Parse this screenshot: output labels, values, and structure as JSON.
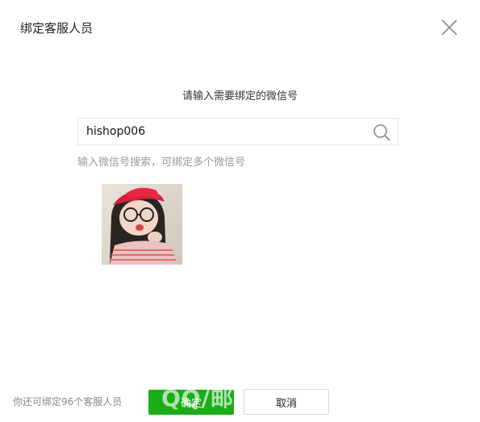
{
  "dialog": {
    "title": "绑定客服人员",
    "close_icon": "close-icon"
  },
  "prompt": "请输入需要绑定的微信号",
  "search": {
    "value": "hishop006",
    "icon": "search-icon"
  },
  "hint": "输入微信号搜索，可绑定多个微信号",
  "result": {
    "avatar": "avatar-photo"
  },
  "footer": {
    "note": "你还可绑定96个客服人员",
    "confirm_label": "确定",
    "cancel_label": "取消"
  },
  "watermark": "QQ/邮",
  "colors": {
    "confirm": "#1aad19",
    "text": "#222222",
    "hint": "#9a9a9a"
  }
}
